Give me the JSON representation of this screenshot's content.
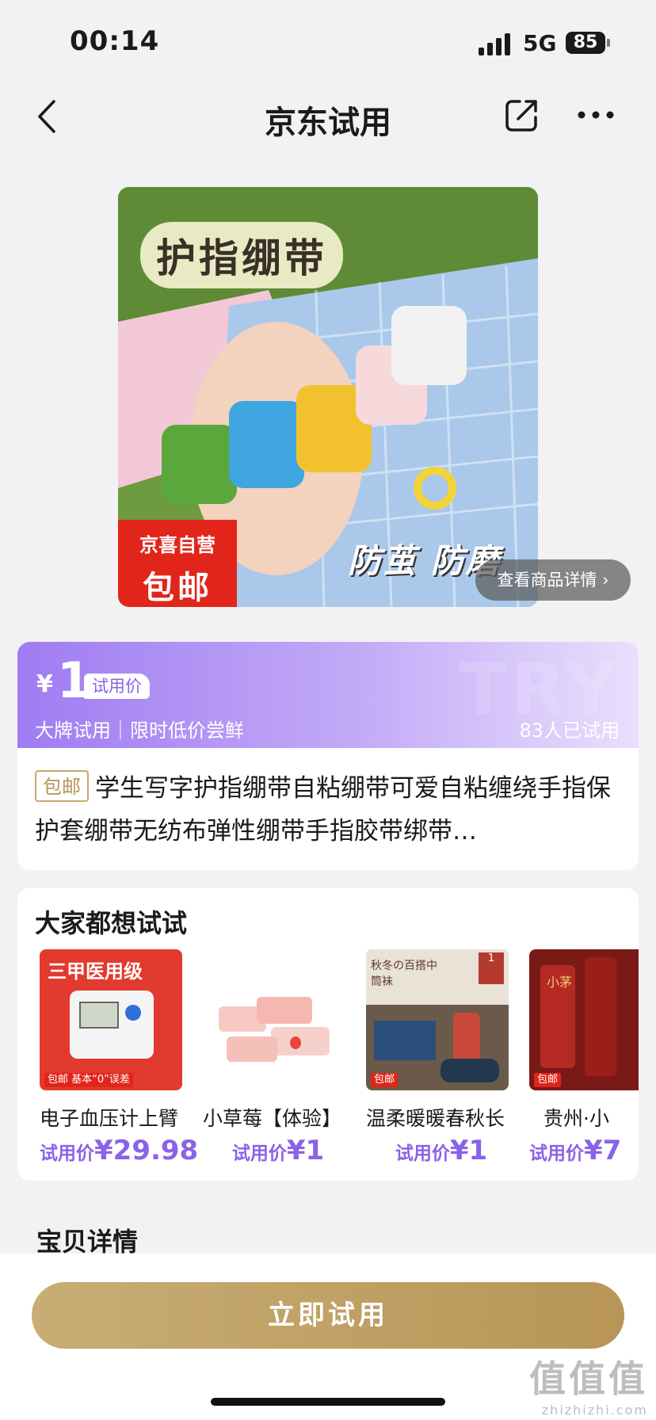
{
  "status_bar": {
    "time": "00:14",
    "network": "5G",
    "battery": "85"
  },
  "nav": {
    "title": "京东试用"
  },
  "hero": {
    "title_text": "护指绷带",
    "badge_line1": "京喜自营",
    "badge_line2": "包邮",
    "slogan": "防茧 防磨",
    "detail_link": "查看商品详情 ›"
  },
  "price_card": {
    "currency": "¥",
    "price": "1",
    "price_tag": "试用价",
    "slogan": "大牌试用｜限时低价尝鲜",
    "tried_count": "83人已试用",
    "watermark": "TRY",
    "ship_badge": "包邮",
    "product_title": "学生写字护指绷带自粘绷带可爱自粘缠绕手指保护套绷带无纺布弹性绷带手指胶带绑带…"
  },
  "recommendations": {
    "title": "大家都想试试",
    "items": [
      {
        "name": "电子血压计上臂",
        "price_label": "试用价",
        "price": "¥29.98",
        "image_text": "三甲医用级",
        "badge_text": "包邮 基本“0”误差"
      },
      {
        "name": "小草莓【体验】",
        "price_label": "试用价",
        "price": "¥1"
      },
      {
        "name": "温柔暖暖春秋长",
        "price_label": "试用价",
        "price": "¥1",
        "image_text": "秋冬の百搭中筒袜",
        "badge_text": "包邮"
      },
      {
        "name": "贵州·小",
        "price_label": "试用价",
        "price": "¥7",
        "image_text": "小茅",
        "badge_text": "包邮"
      }
    ]
  },
  "details": {
    "title": "宝贝详情"
  },
  "bottom": {
    "cta_label": "立即试用",
    "watermark_main": "值值值",
    "watermark_sub": "zhizhizhi.com"
  },
  "colors": {
    "accent_purple": "#8a63e8",
    "cta_gold": "#c3a46a",
    "brand_red": "#e1251b"
  },
  "icons": [
    "back-icon",
    "share-icon",
    "more-icon",
    "signal-icon"
  ]
}
